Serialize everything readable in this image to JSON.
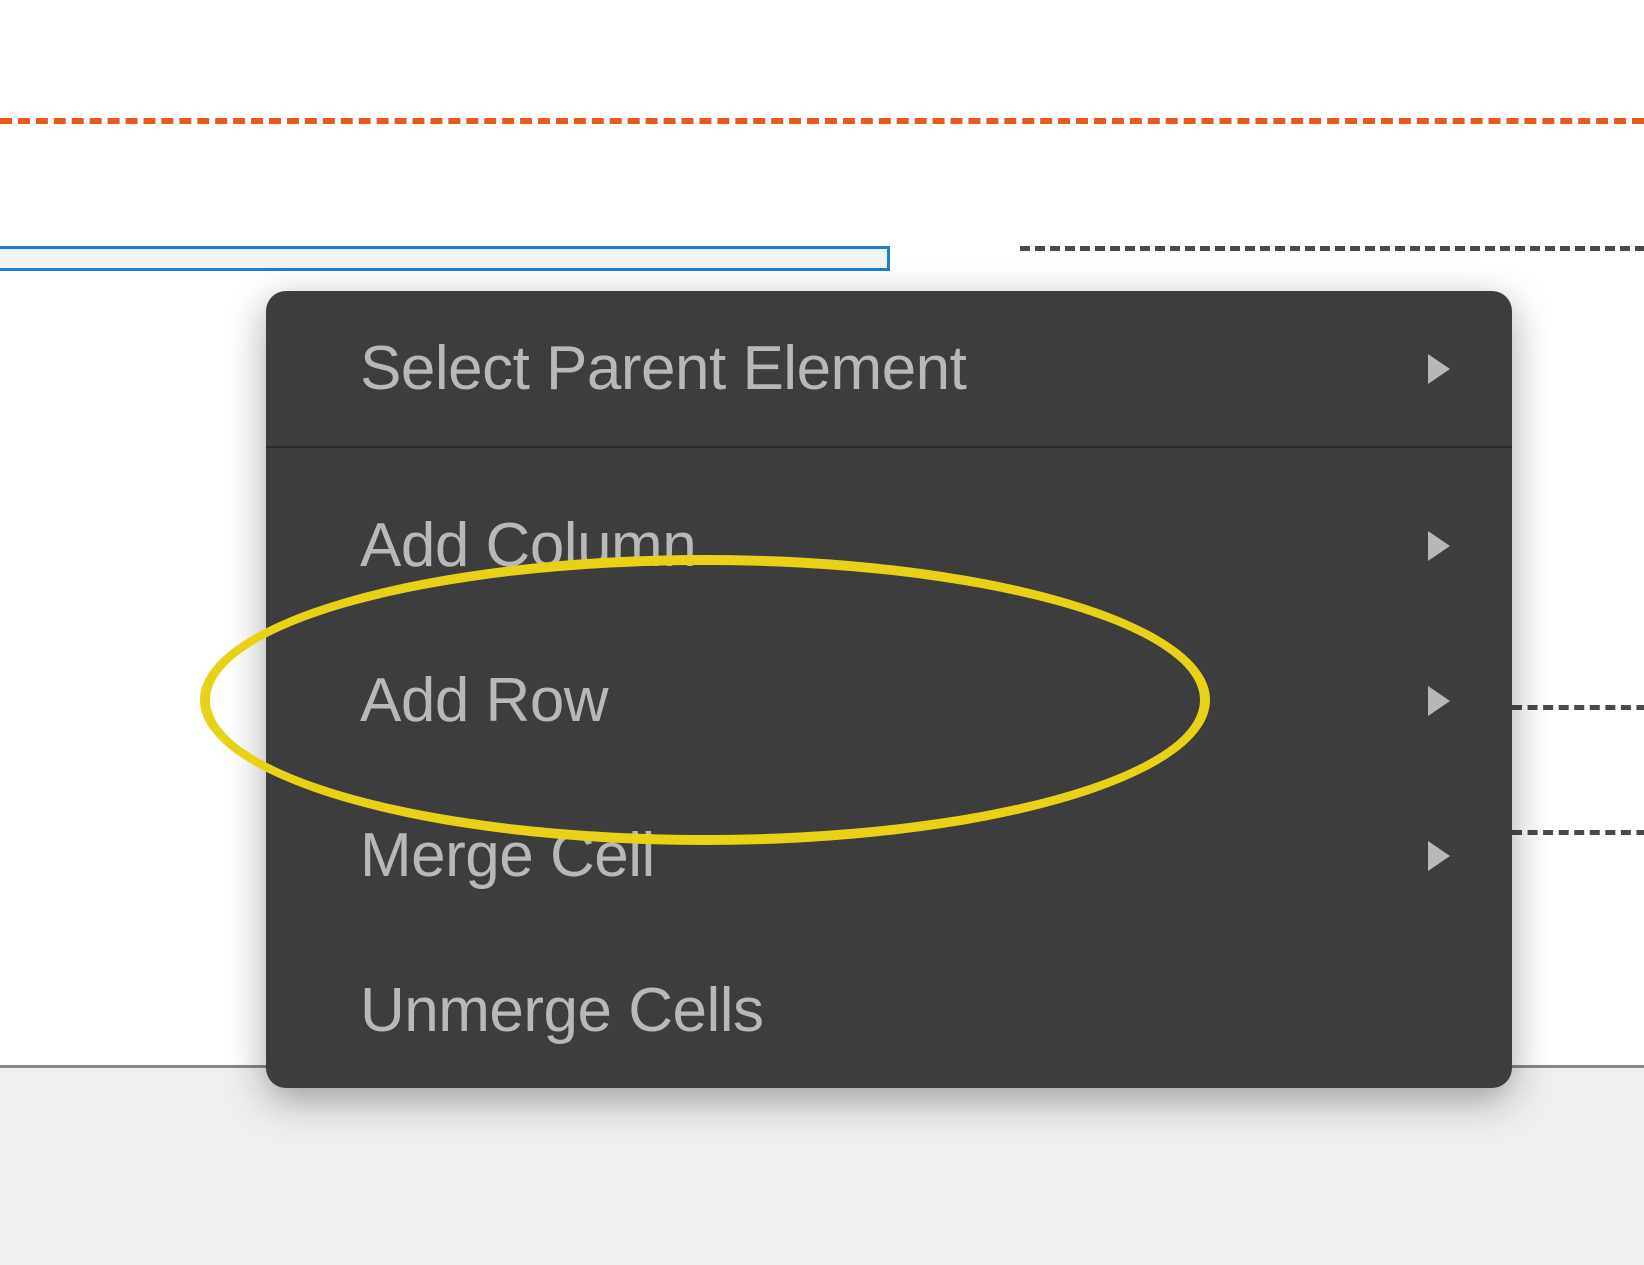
{
  "canvas": {
    "orange_guide": "orange-dashed-guide",
    "selected_cell": "selected-cell",
    "dashed_cell": "dashed-cell"
  },
  "context_menu": {
    "items": [
      {
        "label": "Select Parent Element",
        "has_submenu": true,
        "name": "select-parent-element"
      },
      {
        "label": "Add Column",
        "has_submenu": true,
        "name": "add-column"
      },
      {
        "label": "Add Row",
        "has_submenu": true,
        "name": "add-row"
      },
      {
        "label": "Merge Cell",
        "has_submenu": true,
        "name": "merge-cell"
      },
      {
        "label": "Unmerge Cells",
        "has_submenu": false,
        "name": "unmerge-cells"
      }
    ]
  },
  "annotation": {
    "highlight": "add-column-and-add-row-highlight"
  }
}
